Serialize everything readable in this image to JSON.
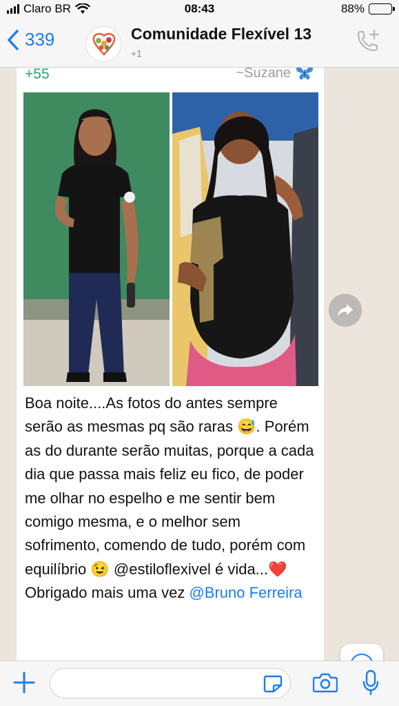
{
  "status_bar": {
    "carrier": "Claro BR",
    "time": "08:43",
    "battery": "88%",
    "battery_level": 0.88
  },
  "header": {
    "back_count": "339",
    "title": "Comunidade Flexível 13",
    "subtitle": "+1"
  },
  "message": {
    "sender_number": "+55",
    "sender_name": "~Suzane",
    "text_part1": "Boa noite....As fotos do antes sempre serão as mesmas pq são raras ",
    "emoji1": "😅",
    "text_part2": ". Porém as do durante serão muitas, porque a cada dia que passa mais feliz eu fico, de poder me olhar no espelho e me sentir bem comigo mesma, e o melhor sem sofrimento, comendo de tudo, porém com equilíbrio ",
    "emoji2": "😉",
    "text_part3": "@estiloflexivel é vida...",
    "emoji3": "❤️",
    "text_part4": " Obrigado mais uma vez ",
    "mention": "@Bruno Ferreira",
    "photo_count": 2
  },
  "colors": {
    "accent": "#1a7cf5",
    "sender": "#27a079",
    "chat_bg": "#ece5dd"
  },
  "icons": [
    "back-chevron-icon",
    "call-add-icon",
    "forward-icon",
    "scroll-down-icon",
    "plus-icon",
    "sticker-icon",
    "camera-icon",
    "mic-icon"
  ]
}
